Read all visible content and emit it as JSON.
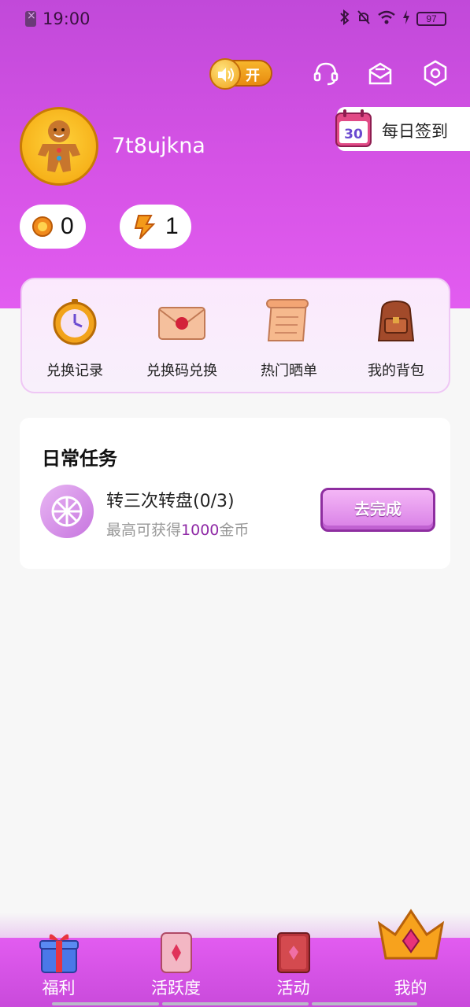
{
  "status_bar": {
    "time": "19:00",
    "battery": "97"
  },
  "header": {
    "sound_toggle_label": "开"
  },
  "profile": {
    "username": "7t8ujkna",
    "signin_label": "每日签到",
    "signin_calendar_number": "30",
    "coin_balance": "0",
    "energy_balance": "1"
  },
  "quick_menu": {
    "items": [
      {
        "label": "兑换记录",
        "icon": "clock-icon"
      },
      {
        "label": "兑换码兑换",
        "icon": "envelope-icon"
      },
      {
        "label": "热门晒单",
        "icon": "scroll-icon"
      },
      {
        "label": "我的背包",
        "icon": "backpack-icon"
      }
    ]
  },
  "daily_tasks": {
    "title": "日常任务",
    "task": {
      "name": "转三次转盘(0/3)",
      "desc_prefix": "最高可获得",
      "desc_amount": "1000",
      "desc_suffix": "金币",
      "button_label": "去完成"
    }
  },
  "bottom_nav": {
    "items": [
      {
        "label": "福利",
        "icon": "gift-icon"
      },
      {
        "label": "活跃度",
        "icon": "card-icon"
      },
      {
        "label": "活动",
        "icon": "book-icon"
      },
      {
        "label": "我的",
        "icon": "crown-icon"
      }
    ]
  },
  "colors": {
    "header_purple": "#d653e6",
    "task_highlight": "#8f2aa6",
    "button_border": "#8e2ea0"
  }
}
